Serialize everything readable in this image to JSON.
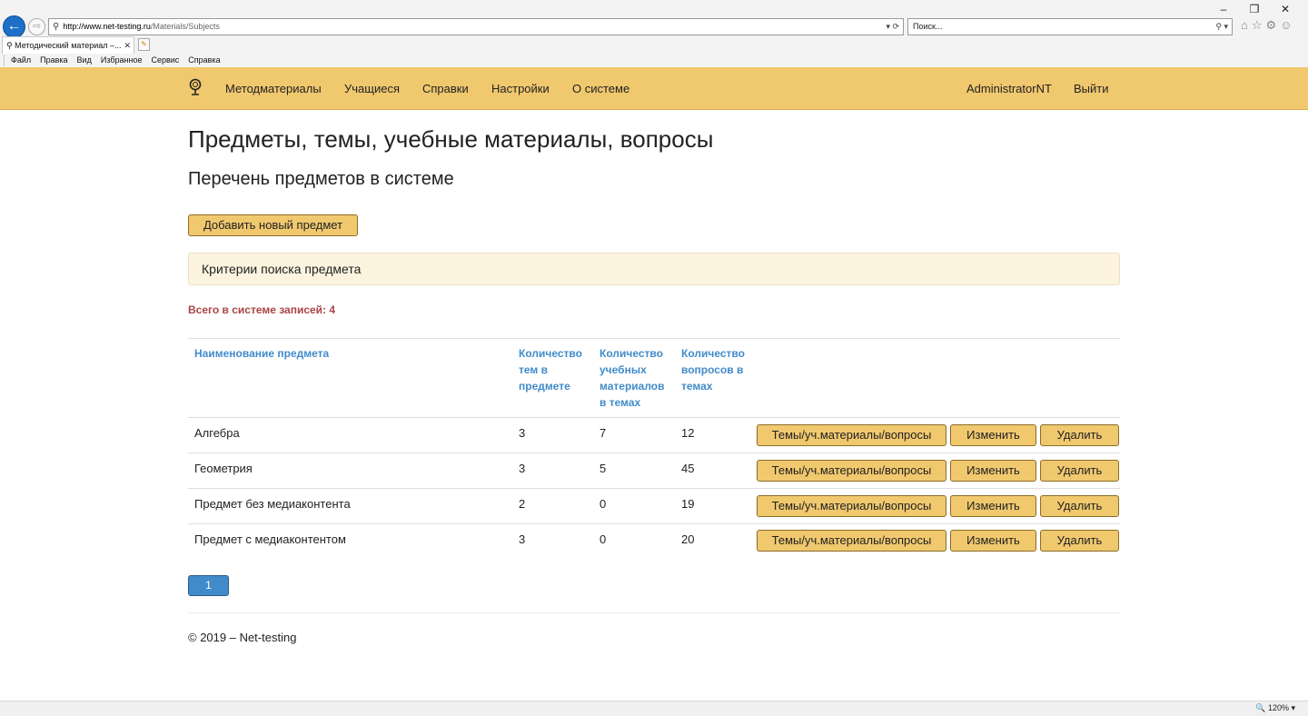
{
  "browser": {
    "url_host": "http://www.net-testing.ru",
    "url_path": "/Materials/Subjects",
    "search_placeholder": "Поиск...",
    "tab_title": "Методический материал –...",
    "menu": [
      "Файл",
      "Правка",
      "Вид",
      "Избранное",
      "Сервис",
      "Справка"
    ],
    "zoom": "120%"
  },
  "nav": {
    "items": [
      "Методматериалы",
      "Учащиеся",
      "Справки",
      "Настройки",
      "О системе"
    ],
    "user": "AdministratorNT",
    "logout": "Выйти"
  },
  "page": {
    "title": "Предметы, темы, учебные материалы, вопросы",
    "subtitle": "Перечень предметов в системе",
    "add_button": "Добавить новый предмет",
    "criteria": "Критерии поиска предмета",
    "total": "Всего в системе записей: 4"
  },
  "table": {
    "headers": {
      "name": "Наименование предмета",
      "topics": [
        "Количество",
        "тем в",
        "предмете"
      ],
      "materials": [
        "Количество",
        "учебных",
        "материалов",
        "в темах"
      ],
      "questions": [
        "Количество",
        "вопросов в",
        "темах"
      ]
    },
    "rows": [
      {
        "name": "Алгебра",
        "topics": "3",
        "materials": "7",
        "questions": "12"
      },
      {
        "name": "Геометрия",
        "topics": "3",
        "materials": "5",
        "questions": "45"
      },
      {
        "name": "Предмет без медиаконтента",
        "topics": "2",
        "materials": "0",
        "questions": "19"
      },
      {
        "name": "Предмет с медиаконтентом",
        "topics": "3",
        "materials": "0",
        "questions": "20"
      }
    ],
    "actions": {
      "topics_button": "Темы/уч.материалы/вопросы",
      "edit_button": "Изменить",
      "delete_button": "Удалить"
    }
  },
  "pager": {
    "current": "1"
  },
  "footer": "© 2019 – Net-testing",
  "colors": {
    "navbar": "#f0c86e",
    "link": "#428bca",
    "total": "#a94442"
  }
}
